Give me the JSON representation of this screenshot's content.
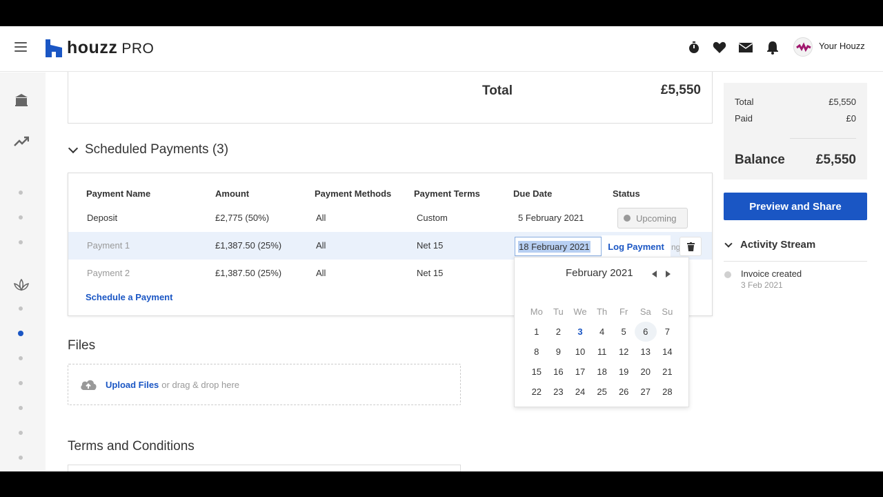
{
  "nav": {
    "brand": "houzz",
    "brand_suffix": "PRO",
    "user_label": "Your Houzz",
    "brand_color": "#1a56c4"
  },
  "totals_card": {
    "label": "Total",
    "value": "£5,550"
  },
  "scheduled": {
    "title": "Scheduled Payments (3)",
    "columns": [
      "Payment Name",
      "Amount",
      "Payment Methods",
      "Payment Terms",
      "Due Date",
      "Status"
    ],
    "rows": [
      {
        "name": "Deposit",
        "amount": "£2,775 (50%)",
        "methods": "All",
        "terms": "Custom",
        "due": "5 February 2021",
        "status": "Upcoming"
      },
      {
        "name": "Payment 1",
        "amount": "£1,387.50 (25%)",
        "methods": "All",
        "terms": "Net 15",
        "due": "18 February 2021",
        "action": "Log Payment",
        "status_fragment": "ng"
      },
      {
        "name": "Payment 2",
        "amount": "£1,387.50 (25%)",
        "methods": "All",
        "terms": "Net 15"
      }
    ],
    "schedule_link": "Schedule a Payment"
  },
  "calendar": {
    "month": "February 2021",
    "weekdays": [
      "Mo",
      "Tu",
      "We",
      "Th",
      "Fr",
      "Sa",
      "Su"
    ],
    "weeks": [
      [
        "1",
        "2",
        "3",
        "4",
        "5",
        "6",
        "7"
      ],
      [
        "8",
        "9",
        "10",
        "11",
        "12",
        "13",
        "14"
      ],
      [
        "15",
        "16",
        "17",
        "18",
        "19",
        "20",
        "21"
      ],
      [
        "22",
        "23",
        "24",
        "25",
        "26",
        "27",
        "28"
      ]
    ],
    "today": "3",
    "hovered": "6"
  },
  "files": {
    "title": "Files",
    "upload_link": "Upload Files",
    "upload_hint": "or drag & drop here"
  },
  "terms": {
    "title": "Terms and Conditions"
  },
  "summary": {
    "total_label": "Total",
    "total_value": "£5,550",
    "paid_label": "Paid",
    "paid_value": "£0",
    "balance_label": "Balance",
    "balance_value": "£5,550"
  },
  "preview_button": "Preview and Share",
  "activity": {
    "title": "Activity Stream",
    "items": [
      {
        "title": "Invoice created",
        "date": "3 Feb 2021"
      }
    ]
  }
}
